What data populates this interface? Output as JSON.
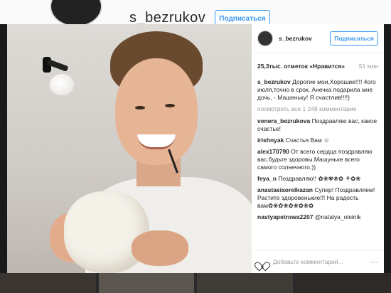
{
  "background": {
    "username": "s_bezrukov",
    "follow_label": "Подписаться"
  },
  "post": {
    "header": {
      "username": "s_bezrukov",
      "follow_label": "Подписаться"
    },
    "likes": "25,3тыс. отметок «Нравится»",
    "time": "51 мин",
    "caption": {
      "username": "s_bezrukov",
      "text": "Дорогие мои,Хорошие!!!! 4ого июля,точно в срок, Анечка подарила мне дочь, - Машеньку! Я счастлив!!!!)"
    },
    "view_all": "посмотреть все 1 248 комментарие",
    "comments": [
      {
        "user": "venera_bezrukova",
        "text": "Поздравляю вас, какое счастье!"
      },
      {
        "user": "irishnyak",
        "text": "Счастья Вам ☺"
      },
      {
        "user": "alex170790",
        "text": "От всего сердца поздравляю вас.будьте здоровы.Машуньке всего самого солнечного.))"
      },
      {
        "user": "feya_n",
        "text": "Поздравляю!! ✿❀✾❀✿ ⚘✿❀"
      },
      {
        "user": "anastasiaorelkazan",
        "text": "Супер! Поздравляем! Растите здоровенькие!!! На радость вам✿❀✿❀✿❀✿❀✿"
      },
      {
        "user": "nastyapetrowa2207",
        "text": "@natalya_oleinik"
      }
    ],
    "footer": {
      "add_comment_placeholder": "Добавьте комментарий...",
      "more": "⋯"
    }
  },
  "colors": {
    "accent": "#3897f0",
    "text": "#262626",
    "muted": "#999999"
  }
}
